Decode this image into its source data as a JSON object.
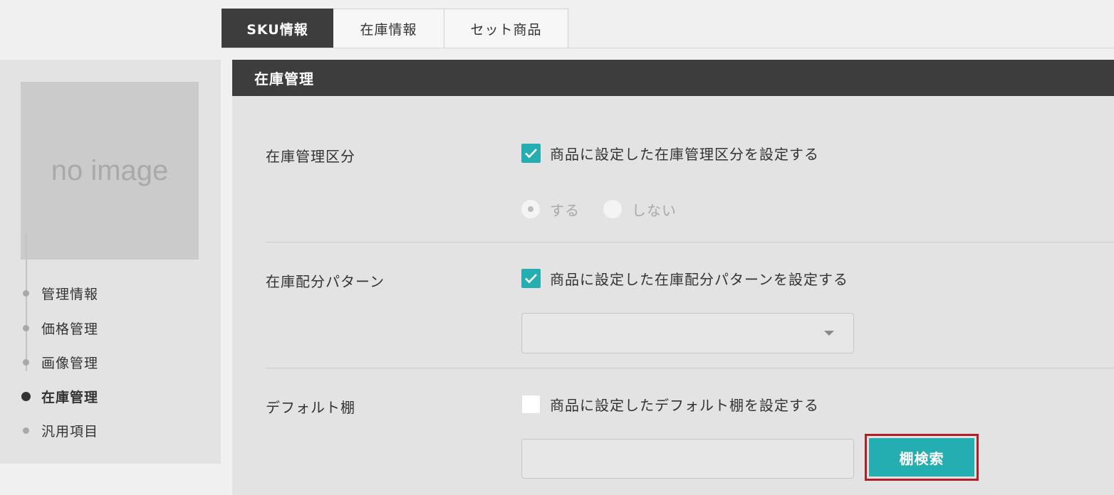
{
  "tabs": [
    {
      "label": "SKU情報",
      "active": true
    },
    {
      "label": "在庫情報",
      "active": false
    },
    {
      "label": "セット商品",
      "active": false
    }
  ],
  "sidebar": {
    "image_placeholder": "no image",
    "items": [
      {
        "label": "管理情報",
        "active": false
      },
      {
        "label": "価格管理",
        "active": false
      },
      {
        "label": "画像管理",
        "active": false
      },
      {
        "label": "在庫管理",
        "active": true
      },
      {
        "label": "汎用項目",
        "active": false
      }
    ]
  },
  "panel": {
    "title": "在庫管理",
    "stock_management": {
      "label": "在庫管理区分",
      "checkbox_label": "商品に設定した在庫管理区分を設定する",
      "checked": true,
      "options": [
        {
          "label": "する",
          "selected": true
        },
        {
          "label": "しない",
          "selected": false
        }
      ]
    },
    "stock_allocation": {
      "label": "在庫配分パターン",
      "checkbox_label": "商品に設定した在庫配分パターンを設定する",
      "checked": true,
      "select_value": ""
    },
    "default_shelf": {
      "label": "デフォルト棚",
      "checkbox_label": "商品に設定したデフォルト棚を設定する",
      "checked": false,
      "input_value": "",
      "search_button": "棚検索"
    }
  },
  "colors": {
    "accent": "#25aeb2",
    "header": "#3d3d3d",
    "highlight_frame": "#b21f28"
  }
}
